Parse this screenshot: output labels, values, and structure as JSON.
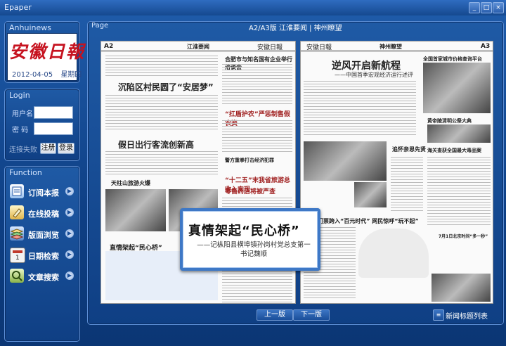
{
  "window": {
    "title": "Epaper",
    "minimize": "_",
    "restore": "□",
    "close": "×"
  },
  "brand_panel": {
    "header": "Anhuinews",
    "logo": "安徽日報",
    "date": "2012-04-05",
    "weekday": "星期四"
  },
  "login": {
    "header": "Login",
    "username_label": "用户名",
    "password_label": "密 码",
    "status": "连接失败",
    "register_button": "注册",
    "login_button": "登录"
  },
  "functions": {
    "header": "Function",
    "items": [
      {
        "label": "订阅本报",
        "icon": "subscribe-icon"
      },
      {
        "label": "在线投稿",
        "icon": "online-submit-icon"
      },
      {
        "label": "版面浏览",
        "icon": "layout-browse-icon"
      },
      {
        "label": "日期检索",
        "icon": "calendar-icon"
      },
      {
        "label": "文章搜索",
        "icon": "article-search-icon"
      }
    ],
    "arrow": "▶"
  },
  "page": {
    "header": "Page",
    "nav": "A2/A3版  江淮要闻 | 神州瞭望"
  },
  "left_page": {
    "section": "A2",
    "section_name": "江淮要闻",
    "masthead": "安徽日報",
    "headlines": [
      "沉陷区村民圆了“安居梦”",
      "合肥市与知名国有企业举行洽谈会",
      "“扛盾护农”严惩制售假农资",
      "假日出行客流创新高",
      "天柱山旅游火爆",
      "警方重拳打击经济犯罪",
      "“十二五”末我省旅游总收入实现",
      "零售药店将被严查",
      "直情架起“民心桥”"
    ]
  },
  "right_page": {
    "section": "A3",
    "section_name": "神州瞭望",
    "masthead": "安徽日報",
    "headlines": [
      "逆风开启新航程",
      "——中国首季宏观经济运行述评",
      "全国首家城市价格查询平台",
      "黄帝陵清明公祭大典",
      "追怀亲恩先贤",
      "海关查获全国最大毒品案",
      "门票跨入“百元时代” 网民惊呼“玩不起”",
      "7月1日北京时间“多一秒”"
    ]
  },
  "popup": {
    "title": "真情架起“民心桥”",
    "subtitle": "——记枞阳县横埠镇孙岗村党总支第一书记魏顺"
  },
  "footer": {
    "prev_button": "上一版",
    "next_button": "下一版",
    "list_icon": "≡",
    "list_label": "新闻标题列表"
  }
}
